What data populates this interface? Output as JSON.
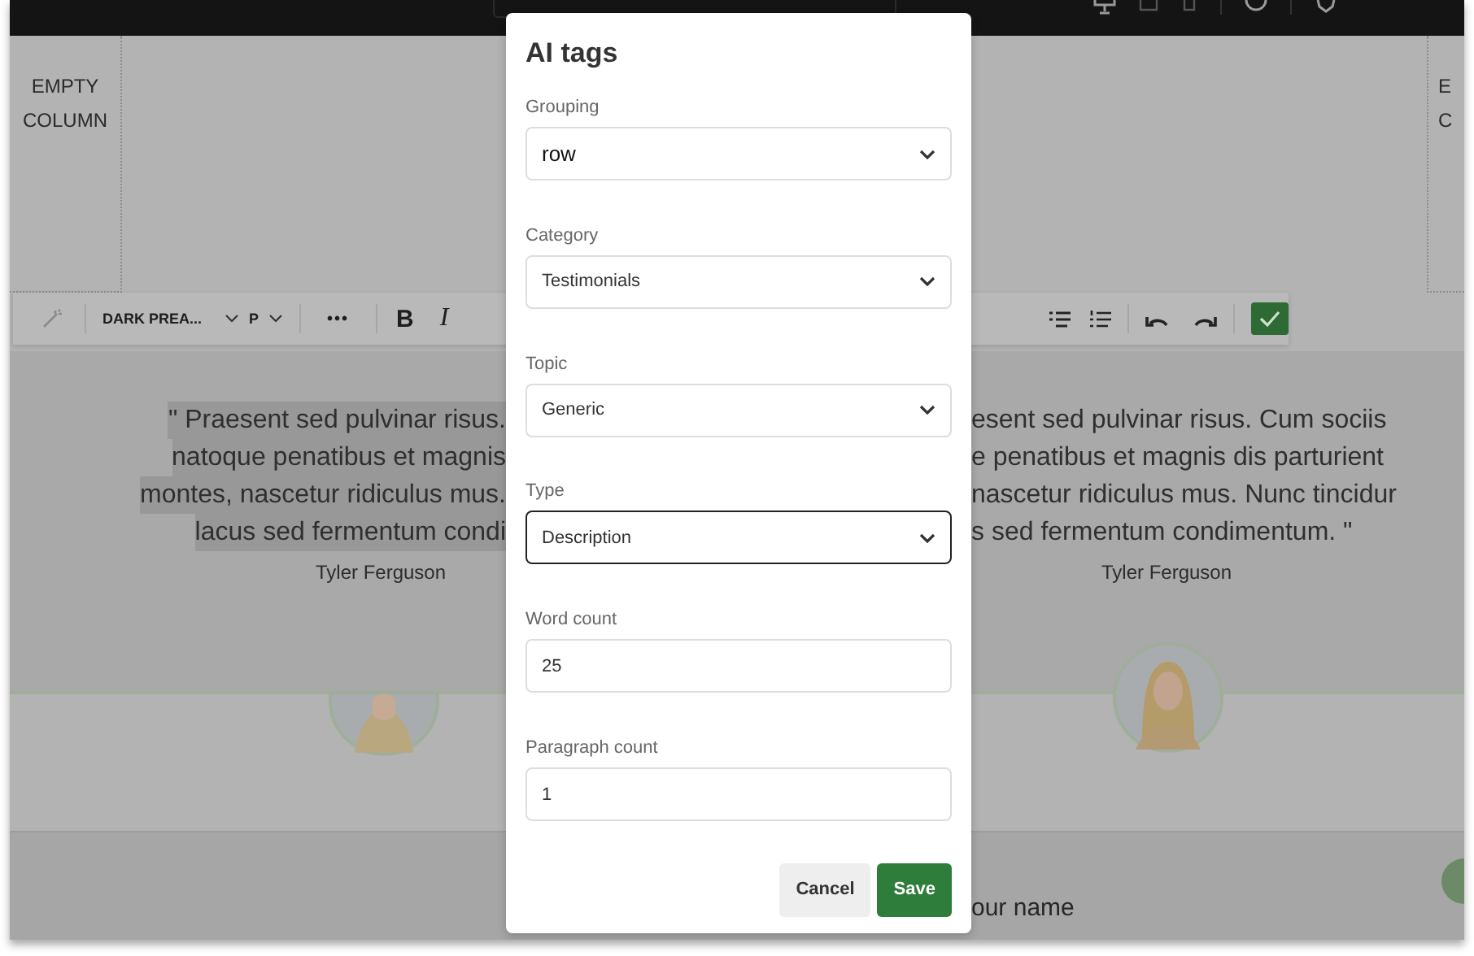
{
  "canvas": {
    "empty_column_left": [
      "EMPTY",
      "COLUMN"
    ],
    "empty_column_right": [
      "E",
      "C"
    ]
  },
  "toolbar": {
    "style": "DARK PREA...",
    "block": "P",
    "more": "•••",
    "bold": "B",
    "italic": "I"
  },
  "testimonials": [
    {
      "lines": [
        "\" Praesent sed pulvinar risus.",
        "natoque penatibus et magnis",
        "montes, nascetur ridiculus mus.",
        "lacus sed fermentum condi"
      ],
      "selected": true,
      "author": "Tyler Ferguson"
    },
    {
      "lines": [
        "esent sed pulvinar risus. Cum sociis",
        "e penatibus et magnis dis parturient",
        "nascetur ridiculus mus. Nunc tincidur",
        "s sed fermentum condimentum. \""
      ],
      "selected": false,
      "author": "Tyler Ferguson"
    }
  ],
  "name_label": "our name",
  "dialog": {
    "title": "AI tags",
    "fields": [
      {
        "kind": "select",
        "label": "Grouping",
        "value": "row",
        "focused": false
      },
      {
        "kind": "select",
        "label": "Category",
        "value": "Testimonials",
        "focused": false
      },
      {
        "kind": "select",
        "label": "Topic",
        "value": "Generic",
        "focused": false
      },
      {
        "kind": "select",
        "label": "Type",
        "value": "Description",
        "focused": true
      },
      {
        "kind": "input",
        "label": "Word count",
        "value": "25",
        "focused": false
      },
      {
        "kind": "input",
        "label": "Paragraph count",
        "value": "1",
        "focused": false
      }
    ],
    "buttons": [
      {
        "label": "Cancel",
        "kind": "secondary"
      },
      {
        "label": "Save",
        "kind": "primary"
      }
    ]
  }
}
